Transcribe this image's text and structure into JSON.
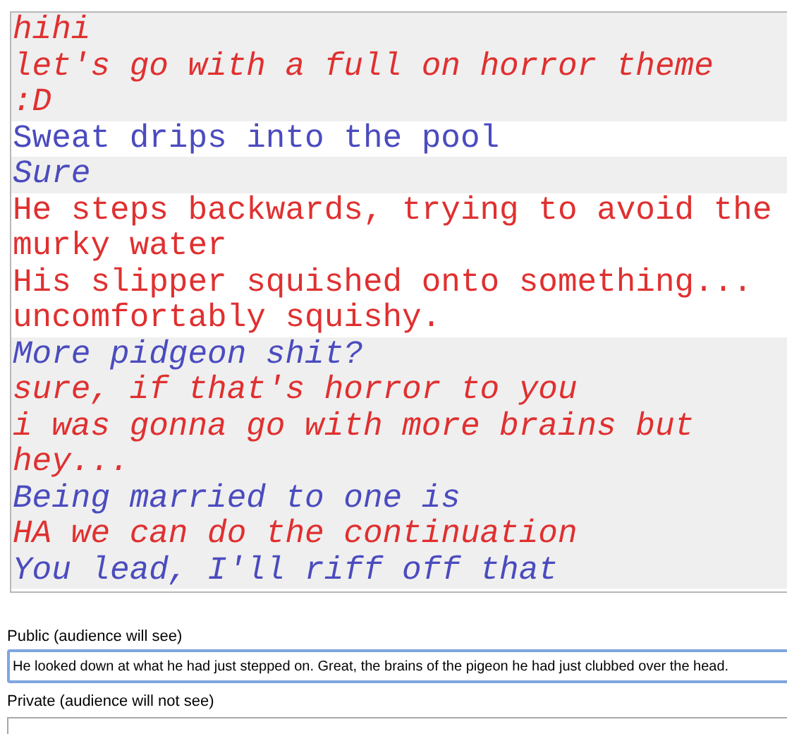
{
  "messages": [
    {
      "text": "hihi",
      "color": "#e03030",
      "ooc": true
    },
    {
      "text": "let's go with a full on horror theme",
      "color": "#e03030",
      "ooc": true
    },
    {
      "text": ":D",
      "color": "#e03030",
      "ooc": true
    },
    {
      "text": "Sweat drips into the pool",
      "color": "#4b4bbf",
      "ooc": false
    },
    {
      "text": "Sure",
      "color": "#4b4bbf",
      "ooc": true
    },
    {
      "text": "He steps backwards, trying to avoid the murky water",
      "color": "#e03030",
      "ooc": false
    },
    {
      "text": "His slipper squished onto something... uncomfortably squishy.",
      "color": "#e03030",
      "ooc": false
    },
    {
      "text": "More pidgeon shit?",
      "color": "#4b4bbf",
      "ooc": true
    },
    {
      "text": "sure, if that's horror to you",
      "color": "#e03030",
      "ooc": true
    },
    {
      "text": "i was gonna go with more brains but hey...",
      "color": "#e03030",
      "ooc": true
    },
    {
      "text": "Being married to one is",
      "color": "#4b4bbf",
      "ooc": true
    },
    {
      "text": "HA we can do the continuation",
      "color": "#e03030",
      "ooc": true
    },
    {
      "text": "You lead, I'll riff off that",
      "color": "#4b4bbf",
      "ooc": true
    }
  ],
  "public_field": {
    "label": "Public (audience will see)",
    "value": "He looked down at what he had just stepped on. Great, the brains of the pigeon he had just clubbed over the head."
  },
  "private_field": {
    "label": "Private (audience will not see)"
  }
}
